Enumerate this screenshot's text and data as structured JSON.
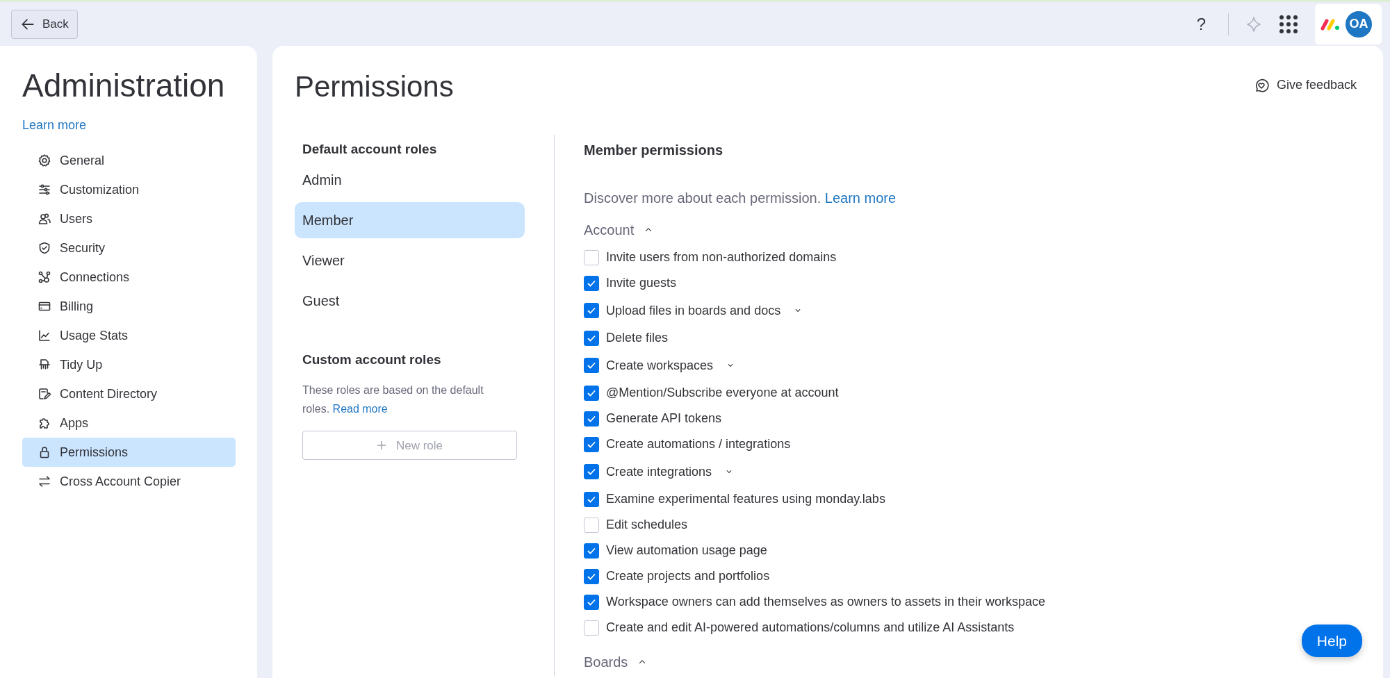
{
  "topbar": {
    "back_label": "Back",
    "help_label": "?",
    "avatar_initials": "OA"
  },
  "sidebar": {
    "title": "Administration",
    "learn_more": "Learn more",
    "items": [
      {
        "label": "General",
        "selected": false
      },
      {
        "label": "Customization",
        "selected": false
      },
      {
        "label": "Users",
        "selected": false
      },
      {
        "label": "Security",
        "selected": false
      },
      {
        "label": "Connections",
        "selected": false
      },
      {
        "label": "Billing",
        "selected": false
      },
      {
        "label": "Usage Stats",
        "selected": false
      },
      {
        "label": "Tidy Up",
        "selected": false
      },
      {
        "label": "Content Directory",
        "selected": false
      },
      {
        "label": "Apps",
        "selected": false
      },
      {
        "label": "Permissions",
        "selected": true
      },
      {
        "label": "Cross Account Copier",
        "selected": false
      }
    ]
  },
  "page": {
    "title": "Permissions",
    "feedback_label": "Give feedback",
    "help_button": "Help"
  },
  "roles": {
    "default_heading": "Default account roles",
    "default_roles": [
      {
        "label": "Admin",
        "selected": false
      },
      {
        "label": "Member",
        "selected": true
      },
      {
        "label": "Viewer",
        "selected": false
      },
      {
        "label": "Guest",
        "selected": false
      }
    ],
    "custom_heading": "Custom account roles",
    "custom_description": "These roles are based on the default roles.",
    "custom_link": "Read more",
    "new_role_button": {
      "label": "New role",
      "disabled": true
    }
  },
  "permissions": {
    "heading": "Member permissions",
    "intro": "Discover more about each permission.",
    "intro_link": "Learn more",
    "sections": [
      {
        "title": "Account",
        "expanded": true,
        "items": [
          {
            "label": "Invite users from non-authorized domains",
            "checked": false,
            "has_options": false
          },
          {
            "label": "Invite guests",
            "checked": true,
            "has_options": false
          },
          {
            "label": "Upload files in boards and docs",
            "checked": true,
            "has_options": true
          },
          {
            "label": "Delete files",
            "checked": true,
            "has_options": false
          },
          {
            "label": "Create workspaces",
            "checked": true,
            "has_options": true
          },
          {
            "label": "@Mention/Subscribe everyone at account",
            "checked": true,
            "has_options": false
          },
          {
            "label": "Generate API tokens",
            "checked": true,
            "has_options": false
          },
          {
            "label": "Create automations / integrations",
            "checked": true,
            "has_options": false
          },
          {
            "label": "Create integrations",
            "checked": true,
            "has_options": true
          },
          {
            "label": "Examine experimental features using monday.labs",
            "checked": true,
            "has_options": false
          },
          {
            "label": "Edit schedules",
            "checked": false,
            "has_options": false
          },
          {
            "label": "View automation usage page",
            "checked": true,
            "has_options": false
          },
          {
            "label": "Create projects and portfolios",
            "checked": true,
            "has_options": false
          },
          {
            "label": "Workspace owners can add themselves as owners to assets in their workspace",
            "checked": true,
            "has_options": false
          },
          {
            "label": "Create and edit AI-powered automations/columns and utilize AI Assistants",
            "checked": false,
            "has_options": false
          }
        ]
      },
      {
        "title": "Boards",
        "expanded": true
      }
    ]
  }
}
